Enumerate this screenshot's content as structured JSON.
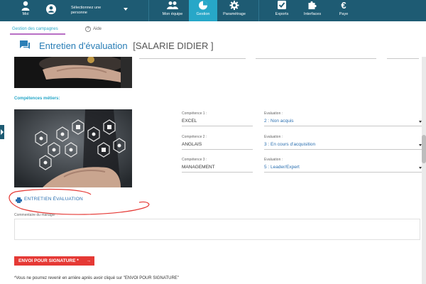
{
  "nav": {
    "moi": "Moi",
    "person_select": "Sélectionnez une personne",
    "items": [
      {
        "label": "Mon équipe",
        "icon": "team-icon"
      },
      {
        "label": "Gestion",
        "icon": "pie-chart-icon"
      },
      {
        "label": "Paramétrage",
        "icon": "gear-icon"
      },
      {
        "label": "Exports",
        "icon": "checkbox-icon"
      },
      {
        "label": "Interfaces",
        "icon": "puzzle-icon"
      },
      {
        "label": "Paye",
        "icon": "euro-icon"
      }
    ]
  },
  "tabs": {
    "campaigns": "Gestion des campagnes",
    "help": "Aide"
  },
  "page": {
    "title": "Entretien d'évaluation",
    "employee": "[SALARIE DIDIER ]"
  },
  "skills": {
    "section_label": "Compétences métiers:",
    "rows": [
      {
        "label": "Compétence 1 :",
        "value": "EXCEL",
        "eval_label": "Evaluation :",
        "eval_value": "2 : Non acquis"
      },
      {
        "label": "Compétence 2 :",
        "value": "ANGLAIS",
        "eval_label": "Evaluation :",
        "eval_value": "3 : En cours d'acquisition"
      },
      {
        "label": "Compétence 3 :",
        "value": "MANAGEMENT",
        "eval_label": "Evaluation :",
        "eval_value": "5 : Leader/Expert"
      }
    ]
  },
  "print_link": "ENTRETIEN ÉVALUATION",
  "comment": {
    "label": "Commentaire du manager :",
    "value": ""
  },
  "send_button": "ENVOI POUR SIGNATURE *",
  "notice": "*Vous ne pourrez revenir en arrière après avoir cliqué sur \"ENVOI POUR SIGNATURE\"",
  "colors": {
    "nav_bg": "#1e5b73",
    "nav_active": "#27a7c8",
    "accent": "#2a7eb6",
    "send_button": "#e53935"
  }
}
